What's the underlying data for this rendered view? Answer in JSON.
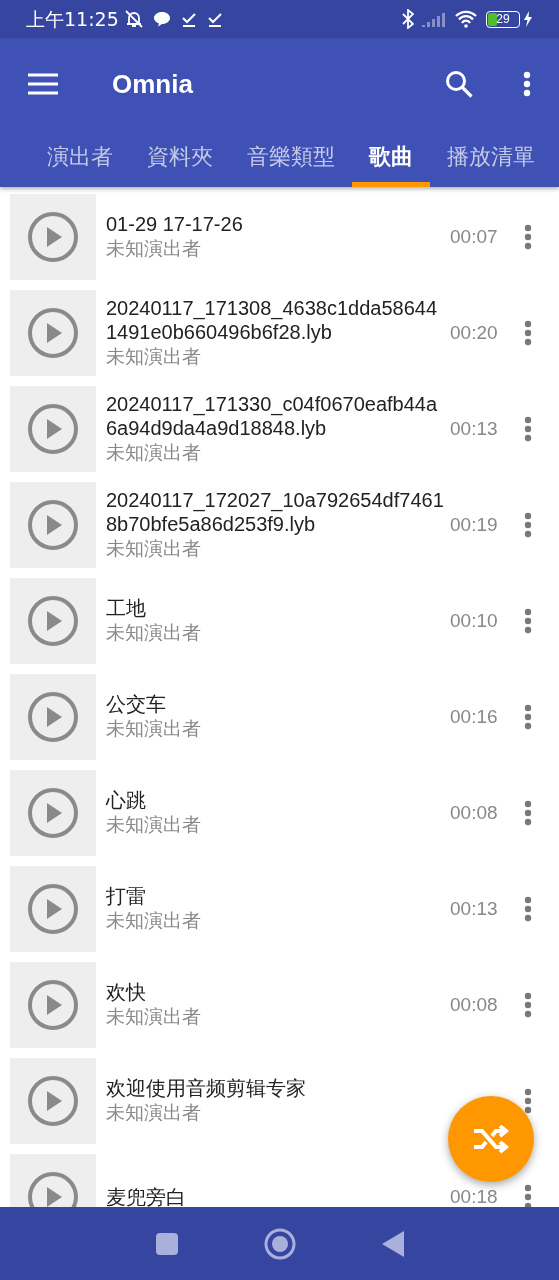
{
  "status_bar": {
    "time": "上午11:25",
    "battery": "29"
  },
  "app_bar": {
    "title": "Omnia"
  },
  "tabs": [
    {
      "label": "演出者",
      "selected": false
    },
    {
      "label": "資料夾",
      "selected": false
    },
    {
      "label": "音樂類型",
      "selected": false
    },
    {
      "label": "歌曲",
      "selected": true
    },
    {
      "label": "播放清單",
      "selected": false
    }
  ],
  "songs": [
    {
      "title": "01-29 17-17-26",
      "artist": "未知演出者",
      "duration": "00:07"
    },
    {
      "title": "20240117_171308_4638c1dda586441491e0b660496b6f28.lyb",
      "artist": "未知演出者",
      "duration": "00:20"
    },
    {
      "title": "20240117_171330_c04f0670eafb44a6a94d9da4a9d18848.lyb",
      "artist": "未知演出者",
      "duration": "00:13"
    },
    {
      "title": "20240117_172027_10a792654df74618b70bfe5a86d253f9.lyb",
      "artist": "未知演出者",
      "duration": "00:19"
    },
    {
      "title": "工地",
      "artist": "未知演出者",
      "duration": "00:10"
    },
    {
      "title": "公交车",
      "artist": "未知演出者",
      "duration": "00:16"
    },
    {
      "title": "心跳",
      "artist": "未知演出者",
      "duration": "00:08"
    },
    {
      "title": "打雷",
      "artist": "未知演出者",
      "duration": "00:13"
    },
    {
      "title": "欢快",
      "artist": "未知演出者",
      "duration": "00:08"
    },
    {
      "title": "欢迎使用音频剪辑专家",
      "artist": "未知演出者"
    },
    {
      "title": "麦兜旁白",
      "duration": "00:18"
    }
  ]
}
